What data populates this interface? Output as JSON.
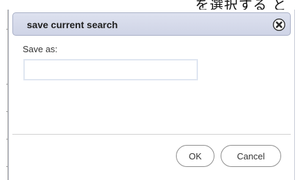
{
  "background_text": "を選択する と",
  "dialog": {
    "title": "save current search",
    "close_icon": "close-icon",
    "save_as_label": "Save as:",
    "save_as_value": "",
    "buttons": {
      "ok_label": "OK",
      "cancel_label": "Cancel"
    }
  },
  "colors": {
    "titlebar_bg": "#d5d9ea",
    "titlebar_border": "#a9b0c7",
    "input_border": "#dfe6f1",
    "close_icon_fill": "#2c2c2c"
  }
}
